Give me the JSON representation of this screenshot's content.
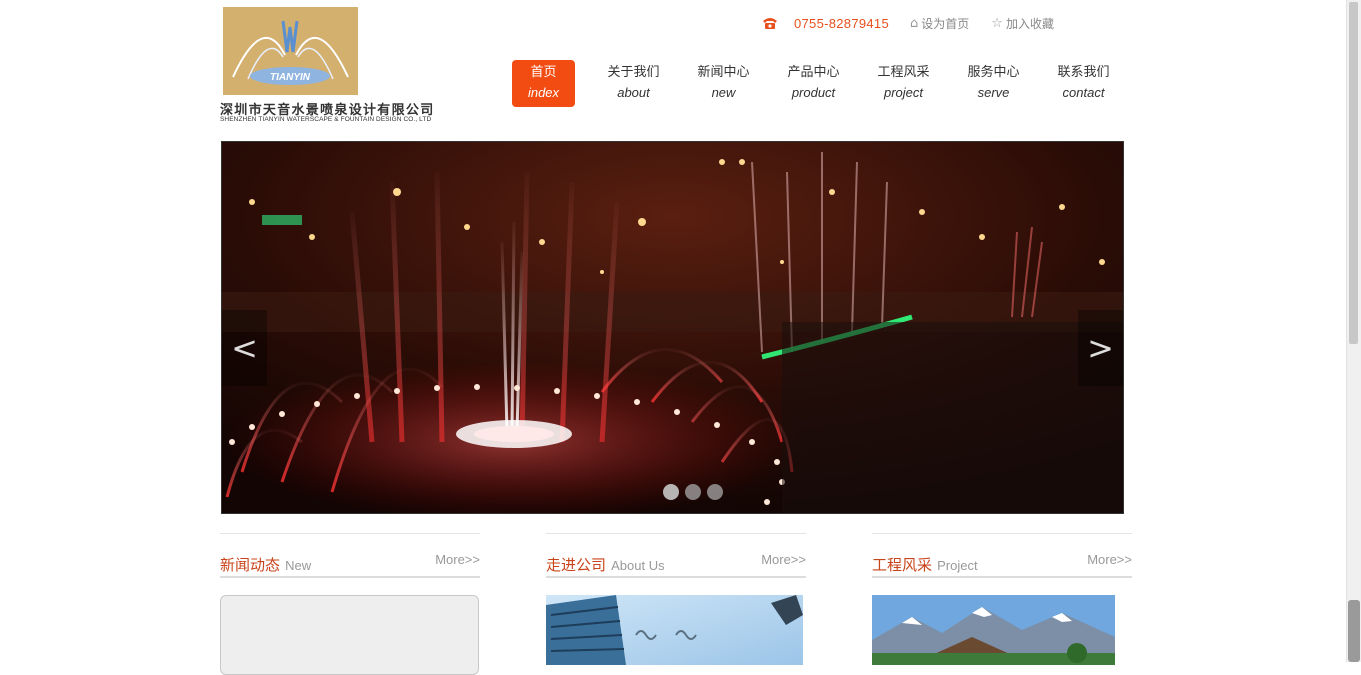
{
  "brand": {
    "logo_text": "TIANYIN",
    "name_cn": "深圳市天音水景喷泉设计有限公司",
    "name_en": "SHENZHEN TIANYIN WATERSCAPE & FOUNTAIN DESIGN CO., LTD"
  },
  "topbar": {
    "phone_icon": "phone-icon",
    "phone": "0755-82879415",
    "homepage_icon": "home-icon",
    "set_homepage": "设为首页",
    "favorite_icon": "star-icon",
    "add_favorite": "加入收藏",
    "accent_color": "#e8501d"
  },
  "nav": {
    "items": [
      {
        "cn": "首页",
        "en": "index"
      },
      {
        "cn": "关于我们",
        "en": "about"
      },
      {
        "cn": "新闻中心",
        "en": "new"
      },
      {
        "cn": "产品中心",
        "en": "product"
      },
      {
        "cn": "工程风采",
        "en": "project"
      },
      {
        "cn": "服务中心",
        "en": "serve"
      },
      {
        "cn": "联系我们",
        "en": "contact"
      }
    ],
    "active_index": 0,
    "active_color": "#f24c13"
  },
  "banner": {
    "prev": "<",
    "next": ">",
    "slide_count": 3,
    "active_slide": 0
  },
  "sections": {
    "news": {
      "title_cn": "新闻动态",
      "title_en": "New",
      "more": "More>>"
    },
    "about": {
      "title_cn": "走进公司",
      "title_en": "About Us",
      "more": "More>>"
    },
    "project": {
      "title_cn": "工程风采",
      "title_en": "Project",
      "more": "More>>"
    },
    "title_color": "#c9441a"
  }
}
